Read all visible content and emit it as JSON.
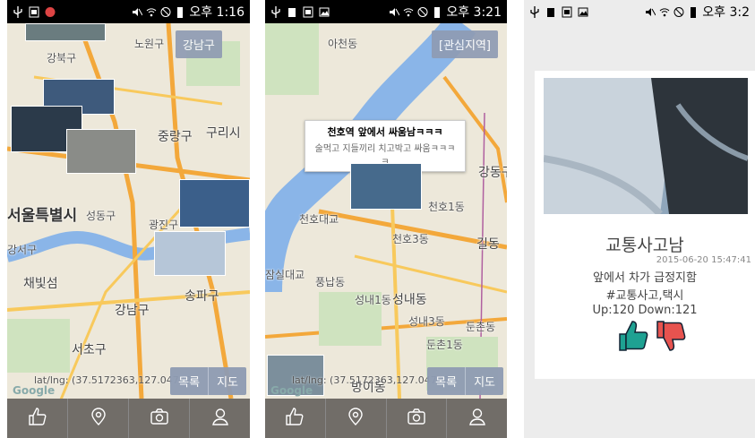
{
  "phone1": {
    "status_time": "오후 1:16",
    "region_button": "강남구",
    "places": [
      "노원구",
      "강북구",
      "중랑구",
      "구리시",
      "서울특별시",
      "성동구",
      "광진구",
      "강서구",
      "채빛섬",
      "송파구",
      "강남구",
      "서초구"
    ],
    "latlng": "lat/lng: (37.5172363,127.04732",
    "list_label": "목록",
    "map_label": "지도",
    "google": "Google"
  },
  "phone2": {
    "status_time": "오후 3:21",
    "region_button": "[관심지역]",
    "places": [
      "아천동",
      "강동구",
      "천호1동",
      "천호대교",
      "천호3동",
      "길동",
      "잠실대교",
      "풍납동",
      "성내1동",
      "성내동",
      "성내3동",
      "둔촌동",
      "둔촌1동",
      "방이동"
    ],
    "info_title": "천호역 앞에서 싸움남ㅋㅋㅋ",
    "info_sub": "술먹고 지들끼리 치고박고 싸움ㅋㅋㅋㅋ",
    "latlng": "lat/lng: (37.5172363,127.04732",
    "list_label": "목록",
    "map_label": "지도",
    "google": "Google"
  },
  "phone3": {
    "status_time": "오후 3:2",
    "post": {
      "title": "교통사고남",
      "date": "2015-06-20 15:47:41",
      "body": "앞에서 차가 급정지함",
      "tags": "#교통사고,택시",
      "votes": "Up:120 Down:121"
    }
  },
  "icons": {
    "tab1": "thumbs-up-icon",
    "tab2": "location-pin-icon",
    "tab3": "camera-icon",
    "tab4": "profile-icon"
  },
  "colors": {
    "bottom_bar": "#716d68",
    "overlay_button": "#8f9cb3",
    "like_green": "#1ea192",
    "dislike_red": "#e7534f"
  }
}
